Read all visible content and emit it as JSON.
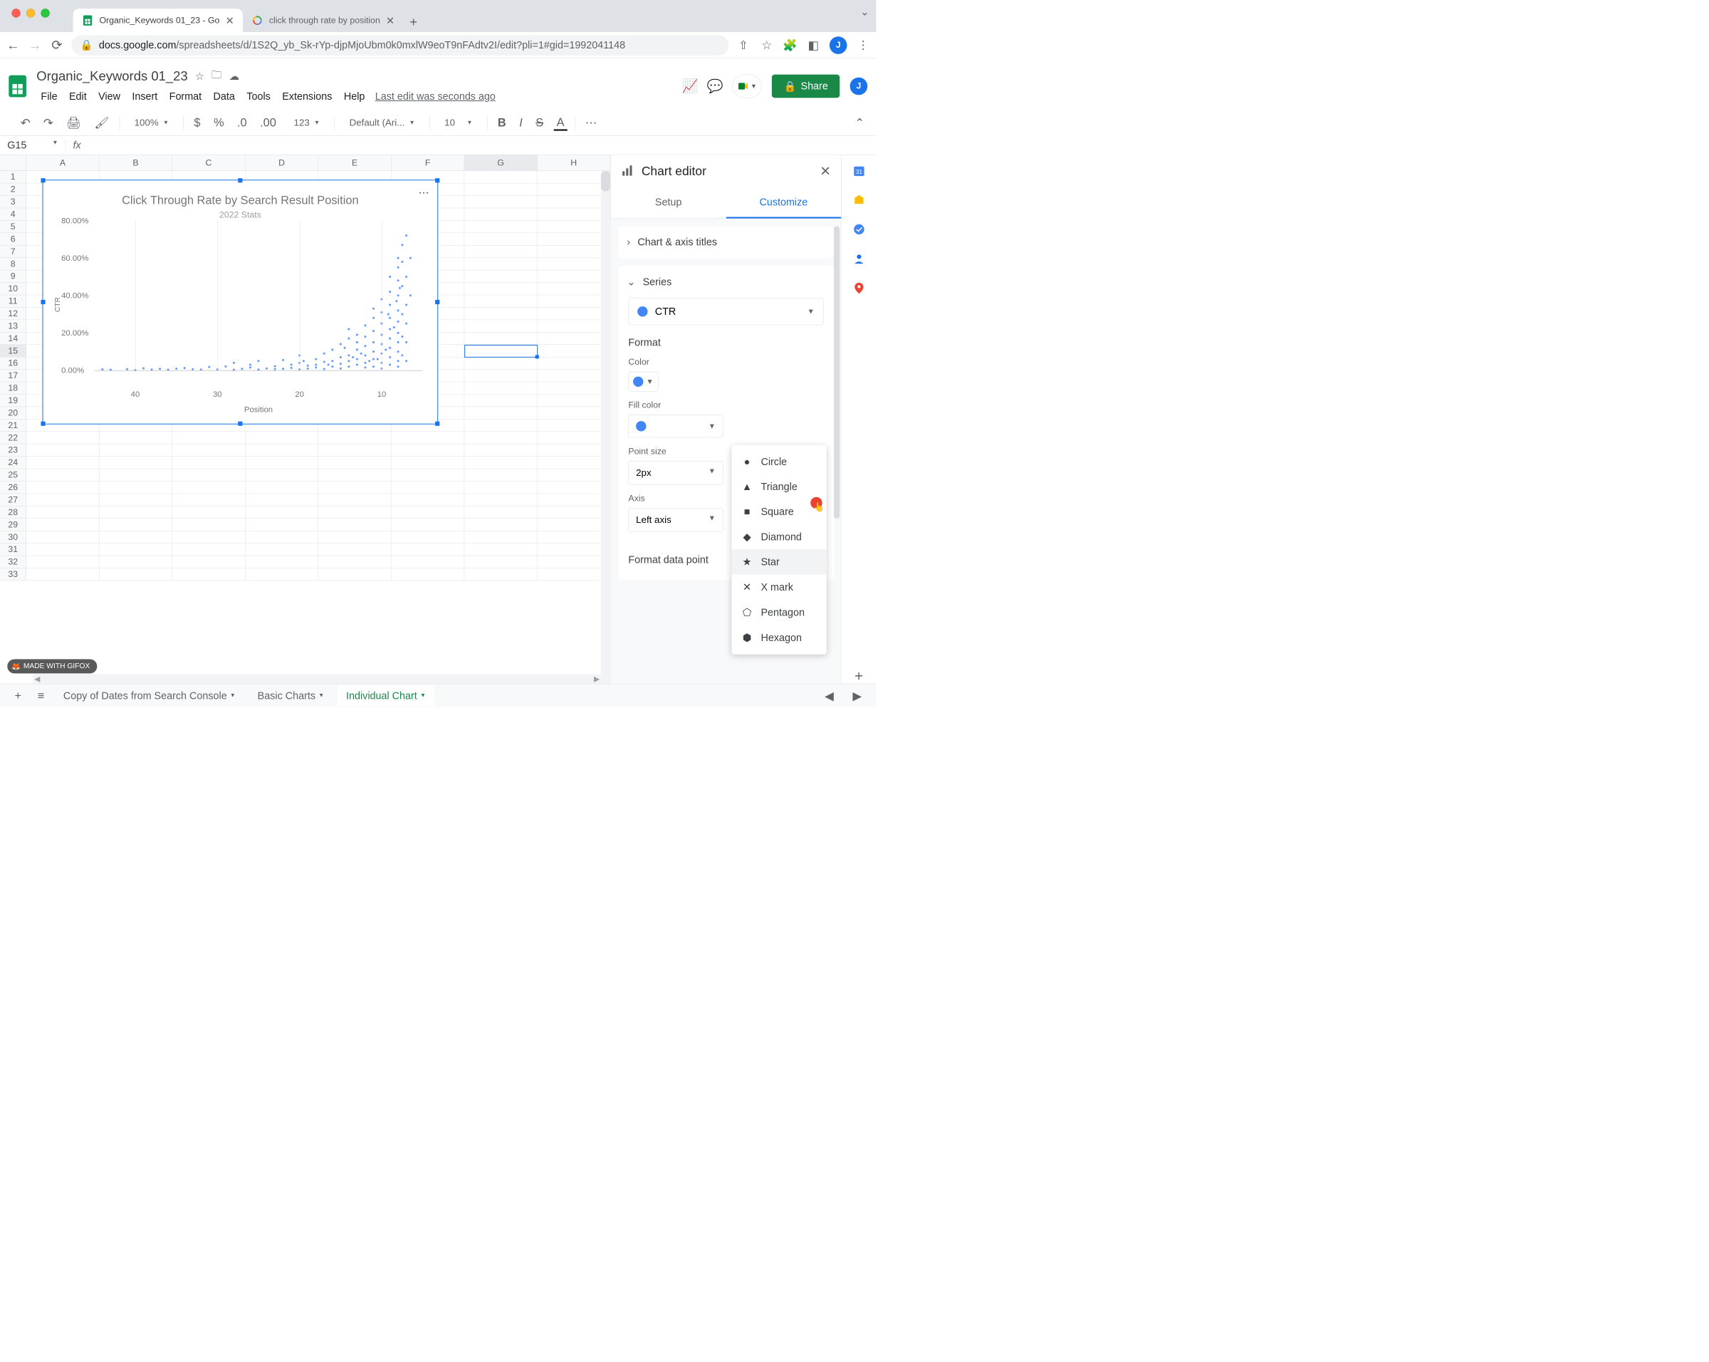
{
  "browser": {
    "tabs": [
      {
        "title": "Organic_Keywords 01_23 - Go",
        "active": true,
        "favicon": "sheets"
      },
      {
        "title": "click through rate by position",
        "active": false,
        "favicon": "google"
      }
    ],
    "url_host": "docs.google.com",
    "url_path": "/spreadsheets/d/1S2Q_yb_Sk-rYp-djpMjoUbm0k0mxlW9eoT9nFAdtv2I/edit?pli=1#gid=1992041148",
    "avatar_initial": "J"
  },
  "app": {
    "doc_title": "Organic_Keywords 01_23",
    "menus": [
      "File",
      "Edit",
      "View",
      "Insert",
      "Format",
      "Data",
      "Tools",
      "Extensions",
      "Help"
    ],
    "last_edit": "Last edit was seconds ago",
    "share": "Share"
  },
  "toolbar": {
    "zoom": "100%",
    "font": "Default (Ari...",
    "font_size": "10",
    "number_fmt": "123"
  },
  "formula": {
    "cell_ref": "G15"
  },
  "grid": {
    "columns": [
      "A",
      "B",
      "C",
      "D",
      "E",
      "F",
      "G",
      "H"
    ],
    "rows": 33
  },
  "panel": {
    "title": "Chart editor",
    "tab_setup": "Setup",
    "tab_customize": "Customize",
    "section_axis": "Chart & axis titles",
    "section_series": "Series",
    "series_name": "CTR",
    "format_heading": "Format",
    "label_color": "Color",
    "label_fill": "Fill color",
    "label_point": "Point size",
    "point_size": "2px",
    "label_axis": "Axis",
    "axis_value": "Left axis",
    "fdp": "Format data point",
    "add": "Add",
    "shapes": [
      "Circle",
      "Triangle",
      "Square",
      "Diamond",
      "Star",
      "X mark",
      "Pentagon",
      "Hexagon"
    ],
    "hovered_shape": "Star",
    "series_color": "#4285f4"
  },
  "sheet_tabs": {
    "tabs": [
      "Copy of Dates from Search Console",
      "Basic Charts",
      "Individual Chart"
    ],
    "active": "Individual Chart"
  },
  "watermark": "MADE WITH GIFOX",
  "chart_data": {
    "type": "scatter",
    "title": "Click Through Rate by Search Result Position",
    "subtitle": "2022 Stats",
    "xlabel": "Position",
    "ylabel": "CTR",
    "xlim": [
      45,
      5
    ],
    "ylim": [
      0,
      80
    ],
    "x_ticks": [
      40,
      30,
      20,
      10
    ],
    "y_ticks": [
      {
        "v": 0,
        "label": "0.00%"
      },
      {
        "v": 20,
        "label": "20.00%"
      },
      {
        "v": 40,
        "label": "40.00%"
      },
      {
        "v": 60,
        "label": "60.00%"
      },
      {
        "v": 80,
        "label": "80.00%"
      }
    ],
    "series": [
      {
        "name": "CTR",
        "color": "#4285f4",
        "points": [
          {
            "x": 44,
            "y": 0.5
          },
          {
            "x": 43,
            "y": 0.3
          },
          {
            "x": 41,
            "y": 0.6
          },
          {
            "x": 40,
            "y": 0.2
          },
          {
            "x": 39,
            "y": 1.1
          },
          {
            "x": 38,
            "y": 0.4
          },
          {
            "x": 37,
            "y": 0.8
          },
          {
            "x": 36,
            "y": 0.3
          },
          {
            "x": 35,
            "y": 0.9
          },
          {
            "x": 34,
            "y": 1.2
          },
          {
            "x": 33,
            "y": 0.6
          },
          {
            "x": 32,
            "y": 0.4
          },
          {
            "x": 31,
            "y": 1.8
          },
          {
            "x": 30,
            "y": 0.5
          },
          {
            "x": 29,
            "y": 2.1
          },
          {
            "x": 28,
            "y": 0.3
          },
          {
            "x": 28,
            "y": 4.0
          },
          {
            "x": 27,
            "y": 0.8
          },
          {
            "x": 26,
            "y": 1.5
          },
          {
            "x": 26,
            "y": 3.0
          },
          {
            "x": 25,
            "y": 0.4
          },
          {
            "x": 25,
            "y": 5.0
          },
          {
            "x": 24,
            "y": 1.0
          },
          {
            "x": 23,
            "y": 0.6
          },
          {
            "x": 23,
            "y": 2.2
          },
          {
            "x": 22,
            "y": 5.5
          },
          {
            "x": 22,
            "y": 0.8
          },
          {
            "x": 21,
            "y": 1.3
          },
          {
            "x": 21,
            "y": 3.0
          },
          {
            "x": 20,
            "y": 0.5
          },
          {
            "x": 20,
            "y": 4.0
          },
          {
            "x": 20,
            "y": 8.0
          },
          {
            "x": 19,
            "y": 0.9
          },
          {
            "x": 19,
            "y": 2.5
          },
          {
            "x": 18,
            "y": 6.0
          },
          {
            "x": 18,
            "y": 1.5
          },
          {
            "x": 18,
            "y": 3.0
          },
          {
            "x": 17,
            "y": 0.7
          },
          {
            "x": 17,
            "y": 4.5
          },
          {
            "x": 17,
            "y": 9.0
          },
          {
            "x": 16,
            "y": 2.0
          },
          {
            "x": 16,
            "y": 5.0
          },
          {
            "x": 16,
            "y": 11.0
          },
          {
            "x": 15,
            "y": 7.0
          },
          {
            "x": 15,
            "y": 1.0
          },
          {
            "x": 15,
            "y": 3.5
          },
          {
            "x": 15,
            "y": 14.0
          },
          {
            "x": 14,
            "y": 8.0
          },
          {
            "x": 14,
            "y": 2.0
          },
          {
            "x": 14,
            "y": 17.0
          },
          {
            "x": 14,
            "y": 5.0
          },
          {
            "x": 14,
            "y": 22.0
          },
          {
            "x": 13,
            "y": 11.0
          },
          {
            "x": 13,
            "y": 3.0
          },
          {
            "x": 13,
            "y": 6.0
          },
          {
            "x": 13,
            "y": 15.0
          },
          {
            "x": 13,
            "y": 19.0
          },
          {
            "x": 12,
            "y": 1.5
          },
          {
            "x": 12,
            "y": 8.0
          },
          {
            "x": 12,
            "y": 24.0
          },
          {
            "x": 12,
            "y": 4.0
          },
          {
            "x": 12,
            "y": 13.0
          },
          {
            "x": 12,
            "y": 18.0
          },
          {
            "x": 11,
            "y": 6.0
          },
          {
            "x": 11,
            "y": 2.0
          },
          {
            "x": 11,
            "y": 10.0
          },
          {
            "x": 11,
            "y": 21.0
          },
          {
            "x": 11,
            "y": 28.0
          },
          {
            "x": 11,
            "y": 15.0
          },
          {
            "x": 11,
            "y": 33.0
          },
          {
            "x": 10,
            "y": 4.0
          },
          {
            "x": 10,
            "y": 9.0
          },
          {
            "x": 10,
            "y": 14.0
          },
          {
            "x": 10,
            "y": 1.0
          },
          {
            "x": 10,
            "y": 19.0
          },
          {
            "x": 10,
            "y": 25.0
          },
          {
            "x": 10,
            "y": 31.0
          },
          {
            "x": 10,
            "y": 38.0
          },
          {
            "x": 9,
            "y": 3.0
          },
          {
            "x": 9,
            "y": 7.0
          },
          {
            "x": 9,
            "y": 12.0
          },
          {
            "x": 9,
            "y": 17.0
          },
          {
            "x": 9,
            "y": 22.0
          },
          {
            "x": 9,
            "y": 28.0
          },
          {
            "x": 9,
            "y": 35.0
          },
          {
            "x": 9,
            "y": 42.0
          },
          {
            "x": 9,
            "y": 50.0
          },
          {
            "x": 8,
            "y": 5.0
          },
          {
            "x": 8,
            "y": 10.0
          },
          {
            "x": 8,
            "y": 2.0
          },
          {
            "x": 8,
            "y": 15.0
          },
          {
            "x": 8,
            "y": 20.0
          },
          {
            "x": 8,
            "y": 26.0
          },
          {
            "x": 8,
            "y": 32.0
          },
          {
            "x": 8,
            "y": 40.0
          },
          {
            "x": 8,
            "y": 48.0
          },
          {
            "x": 8,
            "y": 55.0
          },
          {
            "x": 8,
            "y": 60.0
          },
          {
            "x": 7.5,
            "y": 8.0
          },
          {
            "x": 7.5,
            "y": 18.0
          },
          {
            "x": 7.5,
            "y": 30.0
          },
          {
            "x": 7.5,
            "y": 45.0
          },
          {
            "x": 7.5,
            "y": 58.0
          },
          {
            "x": 7.5,
            "y": 67.0
          },
          {
            "x": 7,
            "y": 72.0
          },
          {
            "x": 7,
            "y": 50.0
          },
          {
            "x": 7,
            "y": 35.0
          },
          {
            "x": 7,
            "y": 25.0
          },
          {
            "x": 7,
            "y": 15.0
          },
          {
            "x": 7,
            "y": 5.0
          },
          {
            "x": 6.5,
            "y": 40.0
          },
          {
            "x": 6.5,
            "y": 60.0
          },
          {
            "x": 10.5,
            "y": 6
          },
          {
            "x": 9.5,
            "y": 11
          },
          {
            "x": 8.5,
            "y": 23
          },
          {
            "x": 11.5,
            "y": 5
          },
          {
            "x": 12.5,
            "y": 9
          },
          {
            "x": 13.5,
            "y": 7
          },
          {
            "x": 14.5,
            "y": 12
          },
          {
            "x": 16.5,
            "y": 3
          },
          {
            "x": 19.5,
            "y": 5
          },
          {
            "x": 9.2,
            "y": 30
          },
          {
            "x": 8.2,
            "y": 37
          },
          {
            "x": 7.8,
            "y": 44
          }
        ]
      }
    ]
  }
}
